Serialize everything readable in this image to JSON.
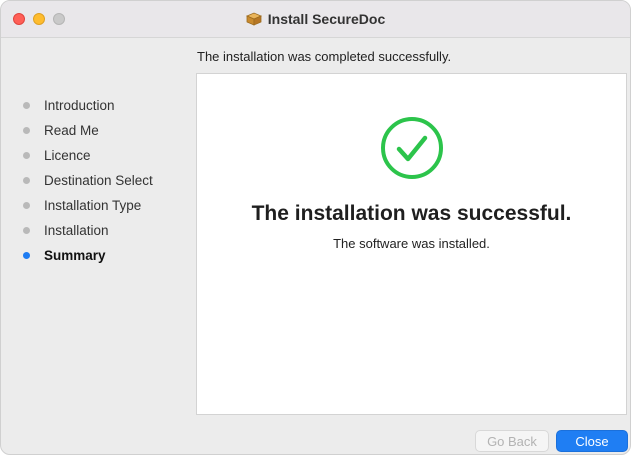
{
  "window": {
    "title": "Install SecureDoc",
    "title_icon": "package-icon",
    "traffic_lights": [
      "close",
      "minimize",
      "zoom"
    ]
  },
  "header": {
    "message": "The installation was completed successfully."
  },
  "sidebar": {
    "steps": [
      {
        "label": "Introduction",
        "active": false
      },
      {
        "label": "Read Me",
        "active": false
      },
      {
        "label": "Licence",
        "active": false
      },
      {
        "label": "Destination Select",
        "active": false
      },
      {
        "label": "Installation Type",
        "active": false
      },
      {
        "label": "Installation",
        "active": false
      },
      {
        "label": "Summary",
        "active": true
      }
    ]
  },
  "main": {
    "status_icon": "checkmark-circle-icon",
    "title": "The installation was successful.",
    "subtitle": "The software was installed."
  },
  "buttons": {
    "back_label": "Go Back",
    "back_enabled": false,
    "close_label": "Close"
  },
  "colors": {
    "accent": "#1f7ef3",
    "success": "#2cc44b",
    "active_step_dot": "#1e7cf2",
    "inactive_step_dot": "#b9b9b9"
  }
}
